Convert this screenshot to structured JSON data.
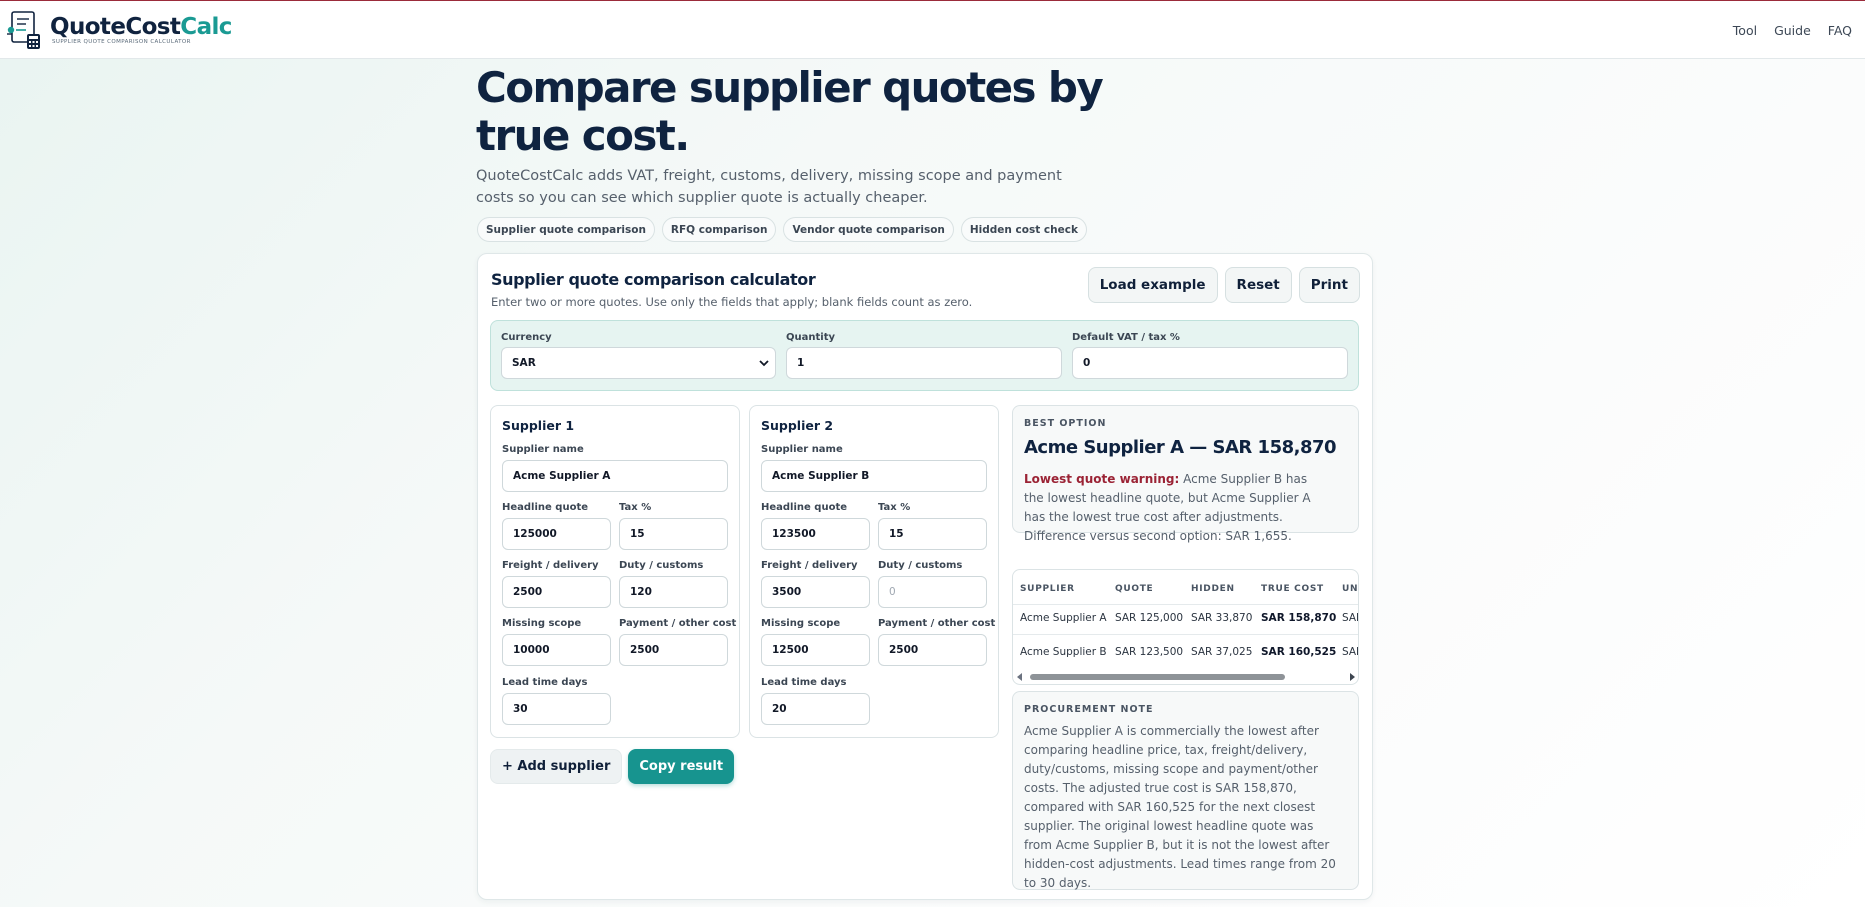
{
  "brand": {
    "name_part1": "QuoteCost",
    "name_part2": "Calc",
    "tagline": "SUPPLIER QUOTE COMPARISON CALCULATOR"
  },
  "nav": {
    "links": [
      "Tool",
      "Guide",
      "FAQ"
    ]
  },
  "hero": {
    "title": "Compare supplier quotes by true cost.",
    "subtitle": "QuoteCostCalc adds VAT, freight, customs, delivery, missing scope and payment costs so you can see which supplier quote is actually cheaper.",
    "chips": [
      "Supplier quote comparison",
      "RFQ comparison",
      "Vendor quote comparison",
      "Hidden cost check"
    ]
  },
  "calculator": {
    "title": "Supplier quote comparison calculator",
    "subtitle": "Enter two or more quotes. Use only the fields that apply; blank fields count as zero.",
    "buttons": {
      "load_example": "Load example",
      "reset": "Reset",
      "print": "Print"
    },
    "settings": {
      "currency_label": "Currency",
      "currency_value": "SAR",
      "quantity_label": "Quantity",
      "quantity_value": "1",
      "vat_label": "Default VAT / tax %",
      "vat_value": "0"
    },
    "field_labels": {
      "name": "Supplier name",
      "headline": "Headline quote",
      "tax": "Tax %",
      "freight": "Freight / delivery",
      "duty": "Duty / customs",
      "missing": "Missing scope",
      "payment": "Payment / other cost",
      "lead": "Lead time days"
    },
    "suppliers": [
      {
        "title": "Supplier 1",
        "name": "Acme Supplier A",
        "headline": "125000",
        "tax": "15",
        "freight": "2500",
        "duty": "120",
        "missing": "10000",
        "payment": "2500",
        "lead": "30"
      },
      {
        "title": "Supplier 2",
        "name": "Acme Supplier B",
        "headline": "123500",
        "tax": "15",
        "freight": "3500",
        "duty": "",
        "duty_placeholder": "0",
        "missing": "12500",
        "payment": "2500",
        "lead": "20"
      }
    ],
    "add_supplier": "+ Add supplier",
    "copy_result": "Copy result",
    "best": {
      "kicker": "BEST OPTION",
      "title": "Acme Supplier A — SAR 158,870",
      "warning_label": "Lowest quote warning:",
      "warning_text": "Acme Supplier B has the lowest headline quote, but Acme Supplier A has the lowest true cost after adjustments. Difference versus second option: SAR 1,655."
    },
    "table": {
      "headers": [
        "SUPPLIER",
        "QUOTE",
        "HIDDEN",
        "TRUE COST",
        "UNI"
      ],
      "rows": [
        [
          "Acme Supplier A",
          "SAR 125,000",
          "SAR 33,870",
          "SAR 158,870",
          "SAR"
        ],
        [
          "Acme Supplier B",
          "SAR 123,500",
          "SAR 37,025",
          "SAR 160,525",
          "SAR"
        ]
      ]
    },
    "note": {
      "kicker": "PROCUREMENT NOTE",
      "text": "Acme Supplier A is commercially the lowest after comparing headline price, tax, freight/delivery, duty/customs, missing scope and payment/other costs. The adjusted true cost is SAR 158,870, compared with SAR 160,525 for the next closest supplier. The original lowest headline quote was from Acme Supplier B, but it is not the lowest after hidden-cost adjustments. Lead times range from 20 to 30 days."
    }
  }
}
